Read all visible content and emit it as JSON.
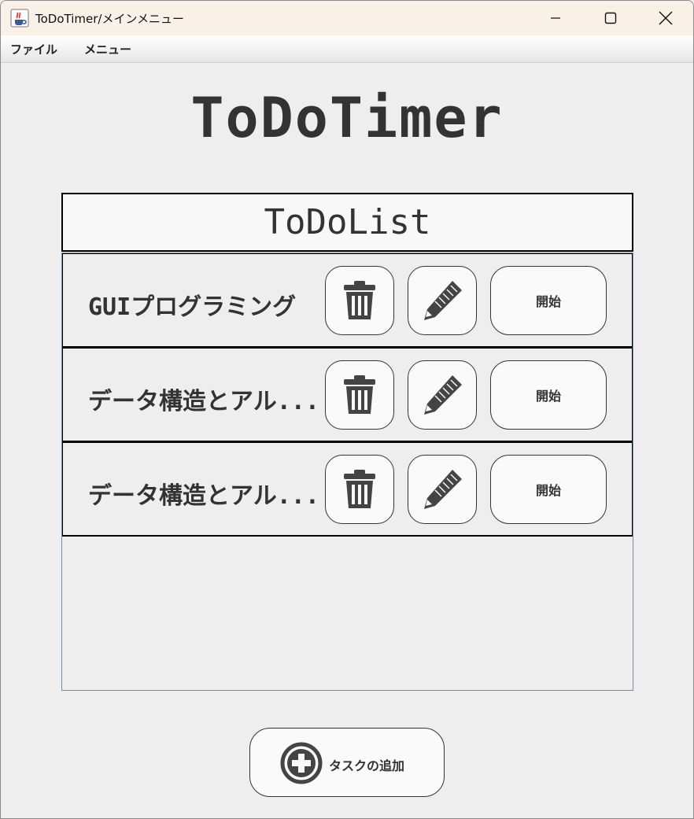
{
  "window": {
    "title": "ToDoTimer/メインメニュー"
  },
  "menubar": {
    "items": [
      {
        "label": "ファイル"
      },
      {
        "label": "メニュー"
      }
    ]
  },
  "main": {
    "app_title": "ToDoTimer",
    "list_title": "ToDoList",
    "tasks": [
      {
        "name": "GUIプログラミング",
        "start_label": "開始"
      },
      {
        "name": "データ構造とアル...",
        "start_label": "開始"
      },
      {
        "name": "データ構造とアル...",
        "start_label": "開始"
      }
    ],
    "add_task_label": "タスクの追加"
  },
  "icons": {
    "app": "java-cup-icon",
    "delete": "trash-icon",
    "edit": "pencil-icon",
    "add": "plus-circle-icon",
    "minimize": "minimize-icon",
    "maximize": "maximize-icon",
    "close": "close-icon"
  },
  "colors": {
    "titlebar": "#f9f1e7",
    "background": "#eeeeee",
    "button_fill": "#fafafa",
    "icon": "#444444",
    "text": "#333333"
  }
}
